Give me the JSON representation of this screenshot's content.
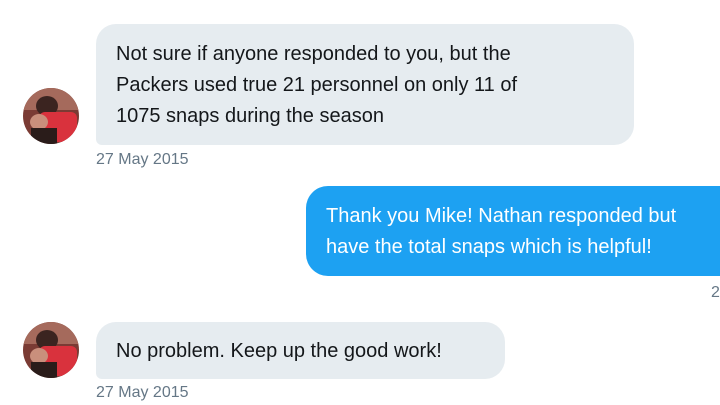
{
  "messages": [
    {
      "direction": "incoming",
      "lines": [
        "Not sure if anyone responded to you, but the",
        "Packers used true 21 personnel on only 11 of",
        "1075 snaps during the season"
      ],
      "timestamp": "27 May 2015"
    },
    {
      "direction": "outgoing",
      "lines": [
        "Thank you Mike! Nathan responded but",
        "have the total snaps which is helpful!"
      ],
      "timestamp": "2"
    },
    {
      "direction": "incoming",
      "lines": [
        "No problem. Keep up the good work!"
      ],
      "timestamp": "27 May 2015"
    }
  ],
  "colors": {
    "incoming_bubble": "#e6ecf0",
    "outgoing_bubble": "#1da1f2",
    "timestamp_text": "#657786",
    "avatar_accent": "#d9323d"
  },
  "icons": {
    "avatar": "user-avatar-icon"
  }
}
